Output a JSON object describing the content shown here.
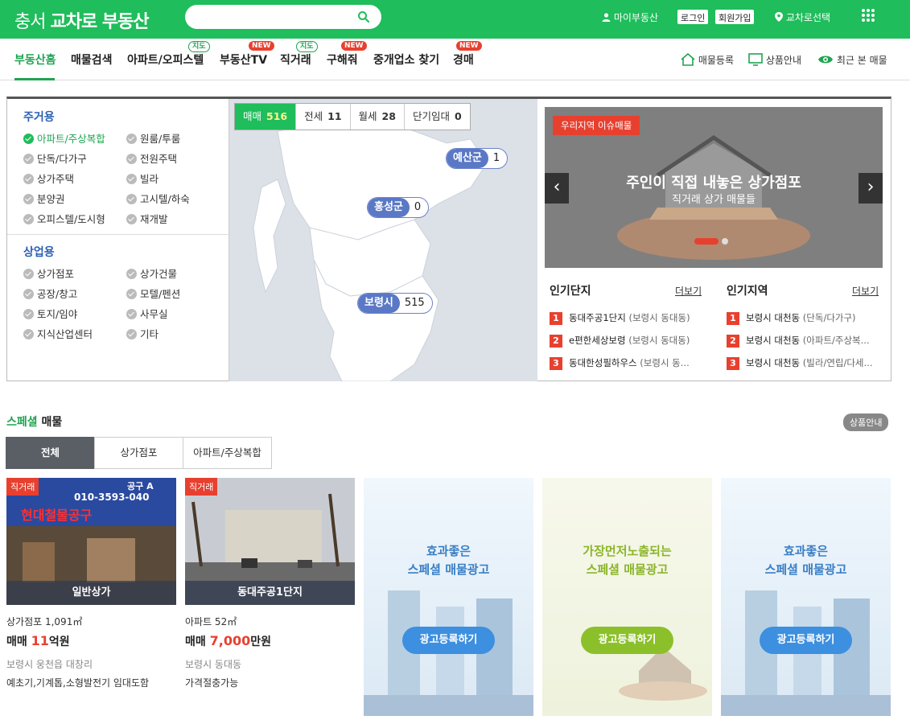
{
  "header": {
    "logo_region": "충서",
    "logo_brand": "교차로 부동산",
    "search_placeholder": "",
    "my_realty": "마이부동산",
    "login": "로그인",
    "signup": "회원가입",
    "region_select": "교차로선택"
  },
  "nav": {
    "items": [
      "부동산홈",
      "매물검색",
      "아파트/오피스텔",
      "부동산TV",
      "직거래",
      "구해줘",
      "중개업소 찾기",
      "경매"
    ],
    "badges": {
      "map": "지도",
      "new": "NEW"
    },
    "right": [
      "매물등록",
      "상품안내",
      "최근 본 매물"
    ]
  },
  "categories": {
    "residential_title": "주거용",
    "residential": [
      "아파트/주상복합",
      "원룸/투룸",
      "단독/다가구",
      "전원주택",
      "상가주택",
      "빌라",
      "분양권",
      "고시텔/하숙",
      "오피스텔/도시형",
      "재개발"
    ],
    "commercial_title": "상업용",
    "commercial": [
      "상가점포",
      "상가건물",
      "공장/창고",
      "모텔/펜션",
      "토지/임야",
      "사무실",
      "지식산업센터",
      "기타"
    ]
  },
  "map": {
    "deal_tabs": [
      {
        "label": "매매",
        "count": "516"
      },
      {
        "label": "전세",
        "count": "11"
      },
      {
        "label": "월세",
        "count": "28"
      },
      {
        "label": "단기임대",
        "count": "0"
      }
    ],
    "regions": [
      {
        "name": "예산군",
        "count": "1"
      },
      {
        "name": "홍성군",
        "count": "0"
      },
      {
        "name": "보령시",
        "count": "515"
      }
    ]
  },
  "banner": {
    "tag": "우리지역 이슈매물",
    "title": "주인이 직접 내놓은 상가점포",
    "subtitle": "직거래 상가 매물들"
  },
  "popular_complex": {
    "title": "인기단지",
    "more": "더보기",
    "items": [
      {
        "rank": "1",
        "name": "동대주공1단지",
        "sub": "(보령시 동대동)"
      },
      {
        "rank": "2",
        "name": "e편한세상보령",
        "sub": "(보령시 동대동)"
      },
      {
        "rank": "3",
        "name": "동대한성필하우스",
        "sub": "(보령시 동..."
      }
    ]
  },
  "popular_region": {
    "title": "인기지역",
    "more": "더보기",
    "items": [
      {
        "rank": "1",
        "name": "보령시 대천동",
        "sub": "(단독/다가구)"
      },
      {
        "rank": "2",
        "name": "보령시 대천동",
        "sub": "(아파트/주상복..."
      },
      {
        "rank": "3",
        "name": "보령시 대천동",
        "sub": "(빌라/연립/다세..."
      }
    ]
  },
  "special": {
    "title_green": "스페셜",
    "title_rest": " 매물",
    "product_info": "상품안내",
    "tabs": [
      "전체",
      "상가점포",
      "아파트/주상복합"
    ],
    "cards": [
      {
        "tag": "직거래",
        "caption": "일반상가",
        "type": "상가점포 1,091㎡",
        "price_prefix": "매매 ",
        "price_num": "11",
        "price_unit": "억원",
        "location": "보령시 웅천읍 대창리",
        "desc": "예초기,기계톱,소형발전기 임대도함",
        "sign_top": "공구 A",
        "sign_phone": "010-3593-040",
        "sign_name": "현대철물공구"
      },
      {
        "tag": "직거래",
        "caption": "동대주공1단지",
        "type": "아파트 52㎡",
        "price_prefix": "매매 ",
        "price_num": "7,000",
        "price_unit": "만원",
        "location": "보령시 동대동",
        "desc": "가격절충가능"
      }
    ],
    "ads": [
      {
        "line1": "효과좋은",
        "line2": "스페셜 매물광고",
        "button": "광고등록하기"
      },
      {
        "line1": "가장먼저노출되는",
        "line2": "스페셜 매물광고",
        "button": "광고등록하기"
      },
      {
        "line1": "효과좋은",
        "line2": "스페셜 매물광고",
        "button": "광고등록하기"
      }
    ]
  },
  "colors": {
    "brand": "#1fbd5b",
    "accent_red": "#e8402f",
    "category_blue": "#2b5fb3",
    "region_pill": "#5a78c6"
  }
}
